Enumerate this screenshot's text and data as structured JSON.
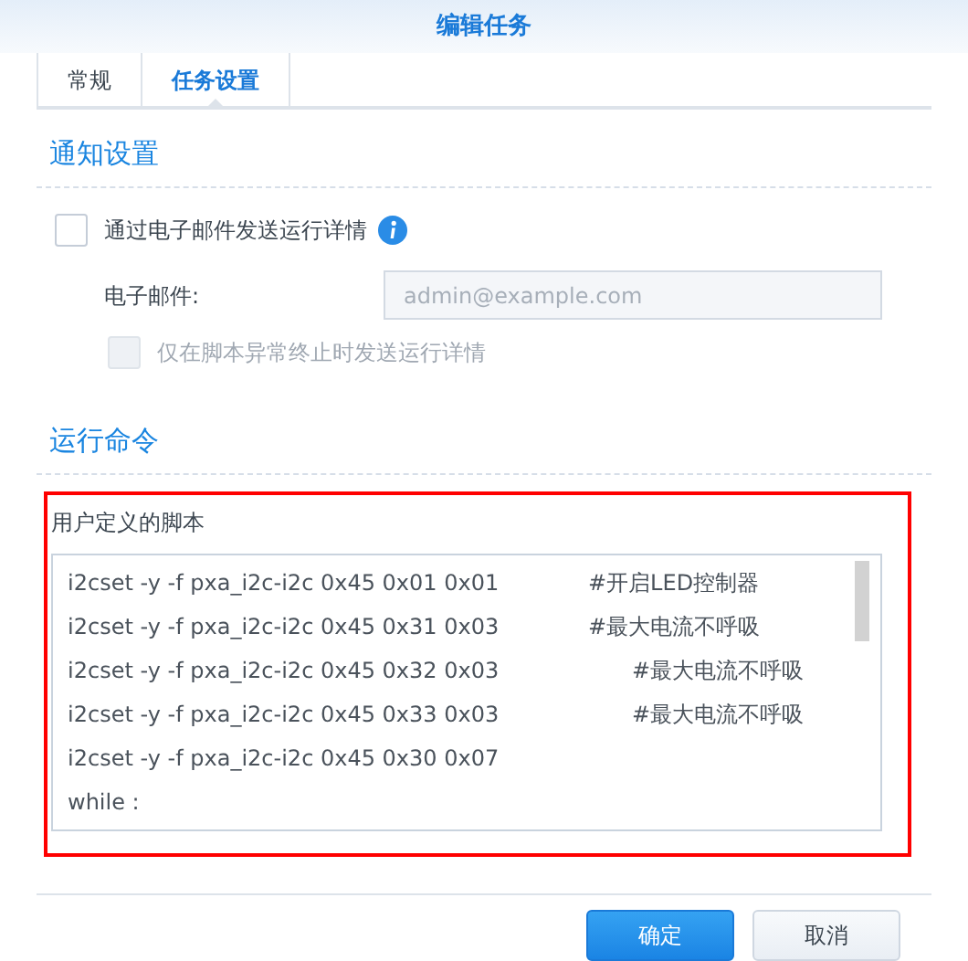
{
  "window": {
    "title": "编辑任务"
  },
  "tabs": [
    {
      "label": "常规",
      "selected": false
    },
    {
      "label": "任务设置",
      "selected": true
    }
  ],
  "notification": {
    "heading": "通知设置",
    "send_email": {
      "label": "通过电子邮件发送运行详情",
      "checked": false
    },
    "email": {
      "label": "电子邮件:",
      "placeholder": "admin@example.com",
      "disabled": true
    },
    "only_on_abnormal": {
      "label": "仅在脚本异常终止时发送运行详情",
      "checked": false,
      "disabled": true
    }
  },
  "run_command": {
    "heading": "运行命令",
    "script_label": "用户定义的脚本",
    "lines": [
      {
        "code": "i2cset -y -f pxa_i2c-i2c 0x45 0x01 0x01",
        "comment": "#开启LED控制器",
        "kind": "near"
      },
      {
        "code": "i2cset -y -f pxa_i2c-i2c 0x45 0x31 0x03",
        "comment": "#最大电流不呼吸",
        "kind": "near"
      },
      {
        "code": "i2cset -y -f pxa_i2c-i2c 0x45 0x32 0x03",
        "comment": "#最大电流不呼吸",
        "kind": "far"
      },
      {
        "code": "i2cset -y -f pxa_i2c-i2c 0x45 0x33 0x03",
        "comment": "#最大电流不呼吸",
        "kind": "far"
      },
      {
        "code": "i2cset -y -f pxa_i2c-i2c 0x45 0x30 0x07"
      },
      {
        "code": "while :"
      }
    ]
  },
  "buttons": [
    {
      "label": "确定",
      "kind": "primary"
    },
    {
      "label": "取消",
      "kind": "secondary"
    }
  ]
}
